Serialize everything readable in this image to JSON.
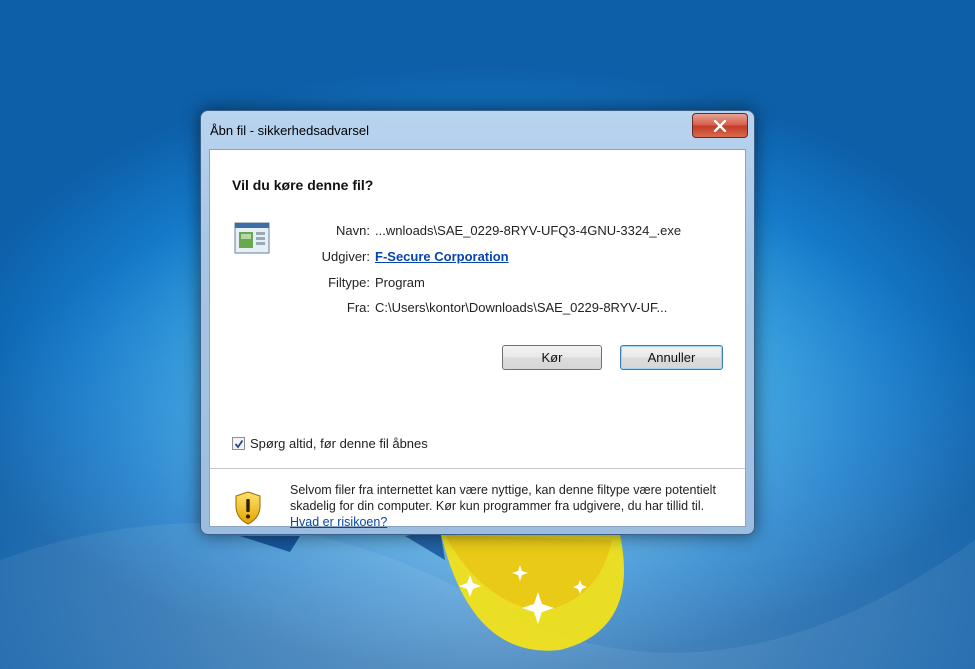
{
  "dialog": {
    "title": "Åbn fil - sikkerhedsadvarsel",
    "close_glyph": "x",
    "heading": "Vil du køre denne fil?",
    "file_icon": "program-file-icon",
    "fields": {
      "name_label": "Navn:",
      "name_value": "...wnloads\\SAE_0229-8RYV-UFQ3-4GNU-3324_.exe",
      "publisher_label": "Udgiver:",
      "publisher_value": "F-Secure Corporation",
      "type_label": "Filtype:",
      "type_value": "Program",
      "from_label": "Fra:",
      "from_value": "C:\\Users\\kontor\\Downloads\\SAE_0229-8RYV-UF..."
    },
    "run_button": "Kør",
    "cancel_button": "Annuller",
    "checkbox": {
      "label": "Spørg altid, før denne fil åbnes",
      "checked": true
    },
    "warning": {
      "icon": "shield-warning-icon",
      "text": "Selvom filer fra internettet kan være nyttige, kan denne filtype være potentielt skadelig for din computer. Kør kun programmer fra udgivere, du har tillid til.",
      "link": "Hvad er risikoen?"
    }
  },
  "colors": {
    "desktop": "#1c8ad6",
    "close_button": "#c94a33",
    "link": "#0645ad"
  }
}
